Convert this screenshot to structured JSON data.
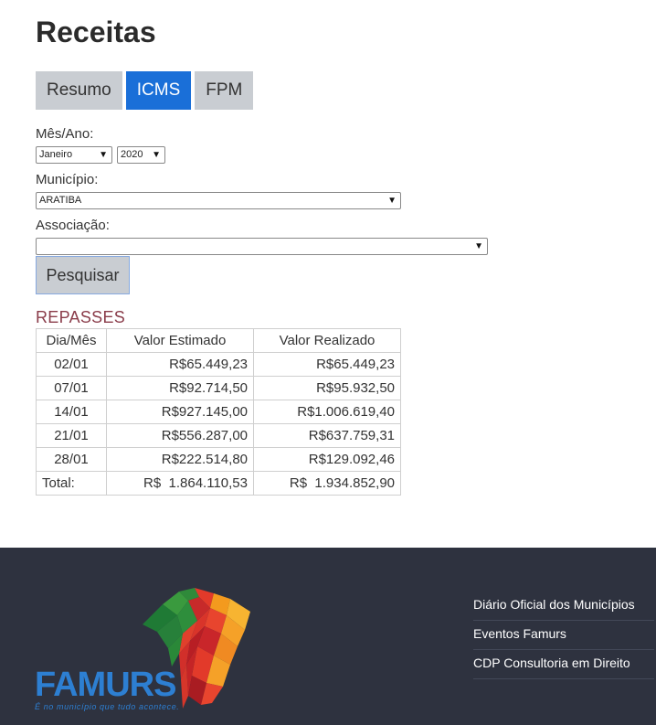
{
  "page": {
    "title": "Receitas"
  },
  "tabs": [
    {
      "label": "Resumo",
      "active": false
    },
    {
      "label": "ICMS",
      "active": true
    },
    {
      "label": "FPM",
      "active": false
    }
  ],
  "filters": {
    "mes_ano_label": "Mês/Ano:",
    "mes_value": "Janeiro",
    "ano_value": "2020",
    "municipio_label": "Município:",
    "municipio_value": "ARATIBA",
    "associacao_label": "Associação:",
    "associacao_value": "",
    "search_label": "Pesquisar"
  },
  "repasses": {
    "title": "REPASSES",
    "headers": [
      "Dia/Mês",
      "Valor Estimado",
      "Valor Realizado"
    ],
    "rows": [
      [
        "02/01",
        "R$65.449,23",
        "R$65.449,23"
      ],
      [
        "07/01",
        "R$92.714,50",
        "R$95.932,50"
      ],
      [
        "14/01",
        "R$927.145,00",
        "R$1.006.619,40"
      ],
      [
        "21/01",
        "R$556.287,00",
        "R$637.759,31"
      ],
      [
        "28/01",
        "R$222.514,80",
        "R$129.092,46"
      ]
    ],
    "total": {
      "label": "Total:",
      "estimado": "R$  1.864.110,53",
      "realizado": "R$  1.934.852,90"
    }
  },
  "footer": {
    "logo_text": "FAMURS",
    "logo_tagline": "É no município que tudo acontece.",
    "links": [
      "Diário Oficial dos Municípios",
      "Eventos Famurs",
      "CDP Consultoria em Direito"
    ]
  },
  "colors": {
    "accent": "#1a6fd8",
    "tab_inactive": "#c9cdd2",
    "section_title": "#8a3c4a",
    "footer_bg": "#2e323f",
    "logo_blue": "#2d7fd2"
  }
}
